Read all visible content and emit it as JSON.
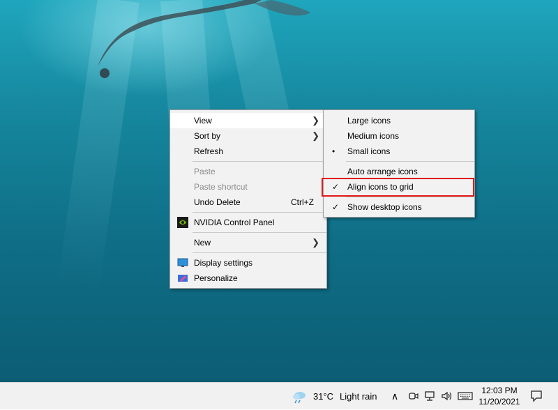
{
  "desktop": {
    "background": "underwater swimmer wallpaper"
  },
  "context_menu": {
    "items": [
      {
        "label": "View",
        "has_submenu": true,
        "highlighted": true
      },
      {
        "label": "Sort by",
        "has_submenu": true
      },
      {
        "label": "Refresh"
      },
      {
        "label": "Paste",
        "disabled": true
      },
      {
        "label": "Paste shortcut",
        "disabled": true
      },
      {
        "label": "Undo Delete",
        "shortcut": "Ctrl+Z"
      },
      {
        "label": "NVIDIA Control Panel",
        "icon": "nvidia-icon"
      },
      {
        "label": "New",
        "has_submenu": true
      },
      {
        "label": "Display settings",
        "icon": "display-icon"
      },
      {
        "label": "Personalize",
        "icon": "personalize-icon"
      }
    ]
  },
  "view_submenu": {
    "items": [
      {
        "label": "Large icons"
      },
      {
        "label": "Medium icons"
      },
      {
        "label": "Small icons",
        "mark": "•",
        "selected": true
      },
      {
        "label": "Auto arrange icons"
      },
      {
        "label": "Align icons to grid",
        "mark": "✓",
        "checked": true
      },
      {
        "label": "Show desktop icons",
        "mark": "✓",
        "checked": true
      }
    ]
  },
  "taskbar": {
    "weather": {
      "temp": "31°C",
      "condition": "Light rain"
    },
    "clock": {
      "time": "12:03 PM",
      "date": "11/20/2021"
    },
    "tray_icons": [
      "chevron-up-icon",
      "meet-now-icon",
      "network-icon",
      "volume-icon",
      "keyboard-icon",
      "notification-icon"
    ]
  },
  "colors": {
    "menu_bg": "#f2f2f2",
    "highlight_border": "#e01a1a",
    "taskbar_bg": "#f1f1f1"
  }
}
